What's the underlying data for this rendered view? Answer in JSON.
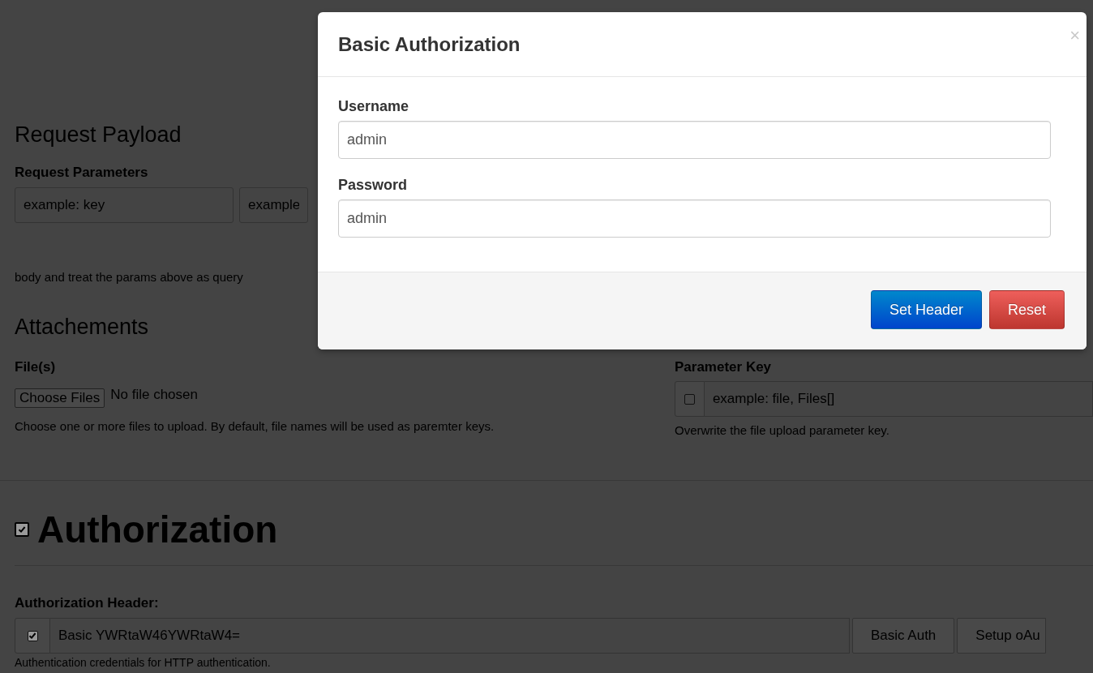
{
  "page": {
    "request_payload": {
      "heading": "Request Payload",
      "parameters_label": "Request Parameters",
      "key_placeholder": "example: key",
      "value_placeholder": "example",
      "help": "body and treat the params above as query"
    },
    "attachments": {
      "heading": "Attachements",
      "files_label": "File(s)",
      "choose_button": "Choose Files",
      "file_status": "No file chosen",
      "files_help": "Choose one or more files to upload. By default, file names will be used as paremter keys.",
      "param_key_label": "Parameter Key",
      "param_key_checked": false,
      "param_key_placeholder": "example: file, Files[]",
      "param_key_help": "Overwrite the file upload parameter key."
    },
    "authorization": {
      "heading": "Authorization",
      "enabled": true,
      "header_label": "Authorization Header:",
      "header_checked": true,
      "header_value": "Basic YWRtaW46YWRtaW4=",
      "buttons": [
        "Basic Auth",
        "Setup oAu"
      ],
      "help": "Authentication credentials for HTTP authentication."
    }
  },
  "modal": {
    "title": "Basic Authorization",
    "close": "×",
    "fields": [
      {
        "label": "Username",
        "value": "admin"
      },
      {
        "label": "Password",
        "value": "admin"
      }
    ],
    "buttons": [
      {
        "label": "Set Header",
        "kind": "primary"
      },
      {
        "label": "Reset",
        "kind": "danger"
      }
    ]
  }
}
